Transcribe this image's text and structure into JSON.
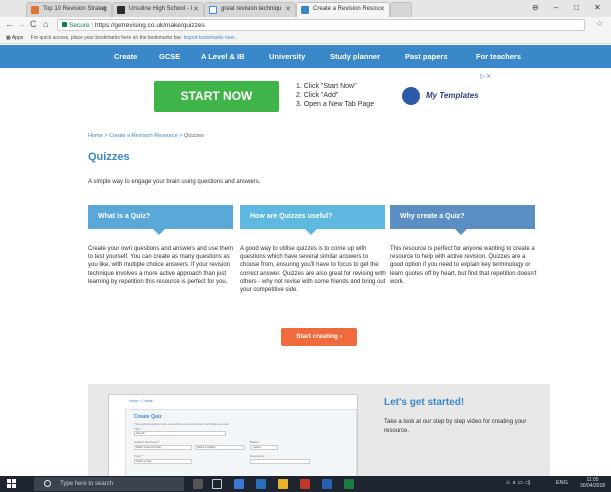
{
  "browser": {
    "tabs": [
      {
        "title": "Top 10 Revision Strateg",
        "fav_color": "#e0732f"
      },
      {
        "title": "Ursuline High School - I",
        "fav_color": "#2b2b2b"
      },
      {
        "title": "great revision techniqu",
        "fav_color": "#ffffff"
      },
      {
        "title": "Create a Revision Resou",
        "fav_color": "#3a88c9"
      }
    ],
    "secure_label": "Secure",
    "url": "https://getrevising.co.uk/make/quizzes",
    "bookmarks_apps": "Apps",
    "bookmarks_hint": "For quick access, place your bookmarks here on the bookmarks bar.",
    "bookmarks_link": "Import bookmarks now..."
  },
  "site_nav": [
    "Create",
    "GCSE",
    "A Level & IB",
    "University",
    "Study planner",
    "Past papers",
    "For teachers"
  ],
  "ad": {
    "button": "START NOW",
    "steps": [
      "1. Click \"Start Now\"",
      "2. Click \"Add\"",
      "3. Open a New Tab Page"
    ],
    "logo_text": "My Templates",
    "adchoice": "▷ ✕"
  },
  "breadcrumb": {
    "home": "Home",
    "sep": " > ",
    "mid": "Create a Revision Resource",
    "current": "Quizzes"
  },
  "page_title": "Quizzes",
  "subtitle": "A simple way to engage your brain using questions and answers.",
  "cards": [
    {
      "title": "What is a Quiz?",
      "text": "Create your own questions and answers and use them to test yourself. You can create as many questions as you like, with multiple choice answers. If your revision technique involves a more active approach than just learning by repetition this resource is perfect for you."
    },
    {
      "title": "How are Quizzes useful?",
      "text": "A good way to utilise quizzes is to come up with questions which have several similar answers to choose from, ensuring you'll have to focus to get the correct answer. Quizzes are also great for revising with others - why not revise with some friends and bring out your competitive side."
    },
    {
      "title": "Why create a Quiz?",
      "text": "This resource is perfect for anyone wanting to create a resource to help with active revision. Quizzes are a good option if you need to explain key terminology or learn quotes off by heart, but find that repetition doesn't work."
    }
  ],
  "start_creating": "Start creating  ›",
  "video": {
    "breadcrumb": "Home > Create",
    "title": "Create Quiz",
    "fine": "The social questions you can add to your quiz once it will help you learn.",
    "title_label": "Title *",
    "title_value": "New ID",
    "subject_label": "Subject and Level *",
    "board_label": "Board *",
    "level_placeholder": "Select a level of study",
    "subject_placeholder": "Select a subject",
    "board_placeholder": "- select -",
    "topic_label": "Topic *",
    "description_label": "Description",
    "topic_placeholder": "Select a topic"
  },
  "lets_get_started": "Let's get started!",
  "lets_desc": "Take a look at our step by step video for creating your resource.",
  "taskbar": {
    "search": "Type here to search",
    "tray": "ENG",
    "time": "11:05",
    "date": "30/04/2018"
  }
}
